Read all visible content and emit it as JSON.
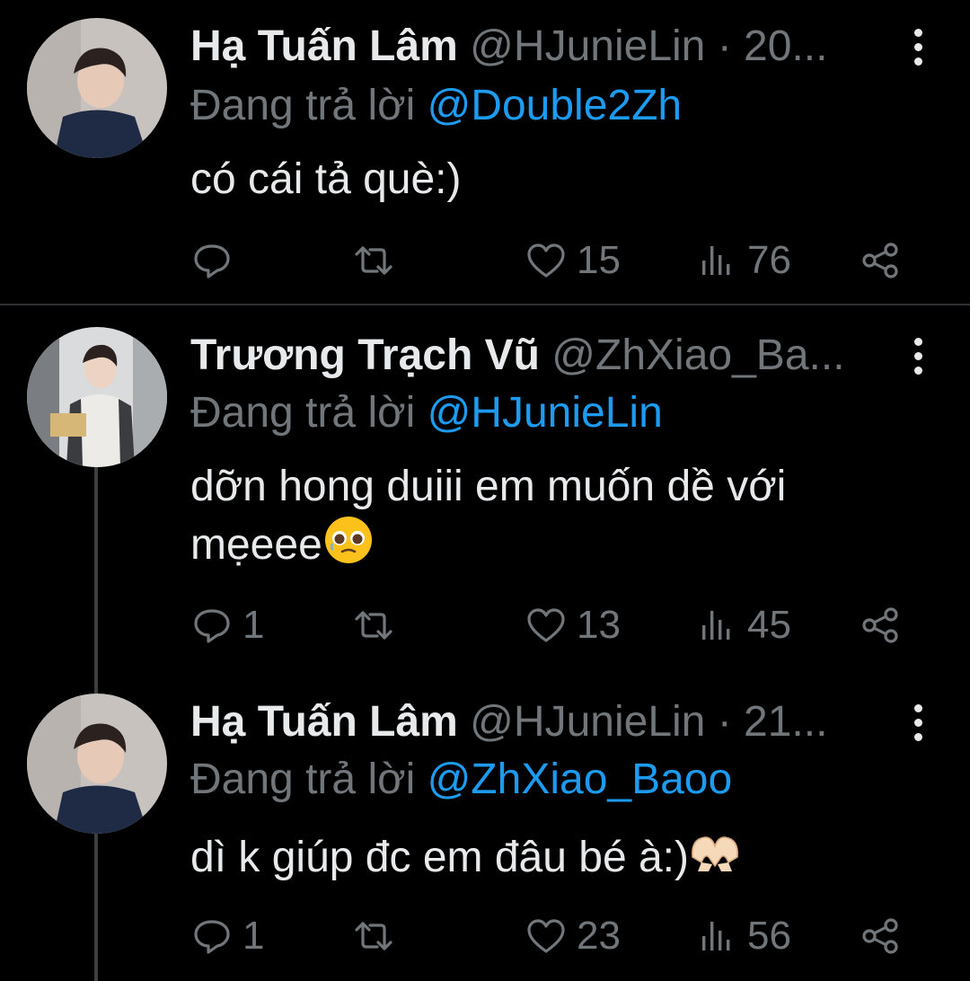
{
  "tweets": [
    {
      "name": "Hạ Tuấn Lâm",
      "handle": "@HJunieLin · 20...",
      "reply_prefix": "Đang trả lời ",
      "reply_to": "@Double2Zh",
      "text": "có cái tả què:)",
      "replies": "",
      "likes": "15",
      "views": "76"
    },
    {
      "name": "Trương Trạch Vũ",
      "handle": "@ZhXiao_Ba...",
      "reply_prefix": "Đang trả lời ",
      "reply_to": "@HJunieLin",
      "text_line1": "dỡn hong duiii em muốn dề với",
      "text_line2": "mẹeee",
      "replies": "1",
      "likes": "13",
      "views": "45"
    },
    {
      "name": "Hạ Tuấn Lâm",
      "handle": "@HJunieLin · 21...",
      "reply_prefix": "Đang trả lời ",
      "reply_to": "@ZhXiao_Baoo",
      "text": "dì k giúp đc em đâu bé à:)",
      "replies": "1",
      "likes": "23",
      "views": "56"
    }
  ],
  "colors": {
    "background": "#000000",
    "text": "#e7e9ea",
    "muted": "#71767b",
    "mention": "#1d9bf0"
  },
  "icons": [
    "reply-icon",
    "retweet-icon",
    "like-icon",
    "views-icon",
    "share-icon",
    "more-icon"
  ]
}
